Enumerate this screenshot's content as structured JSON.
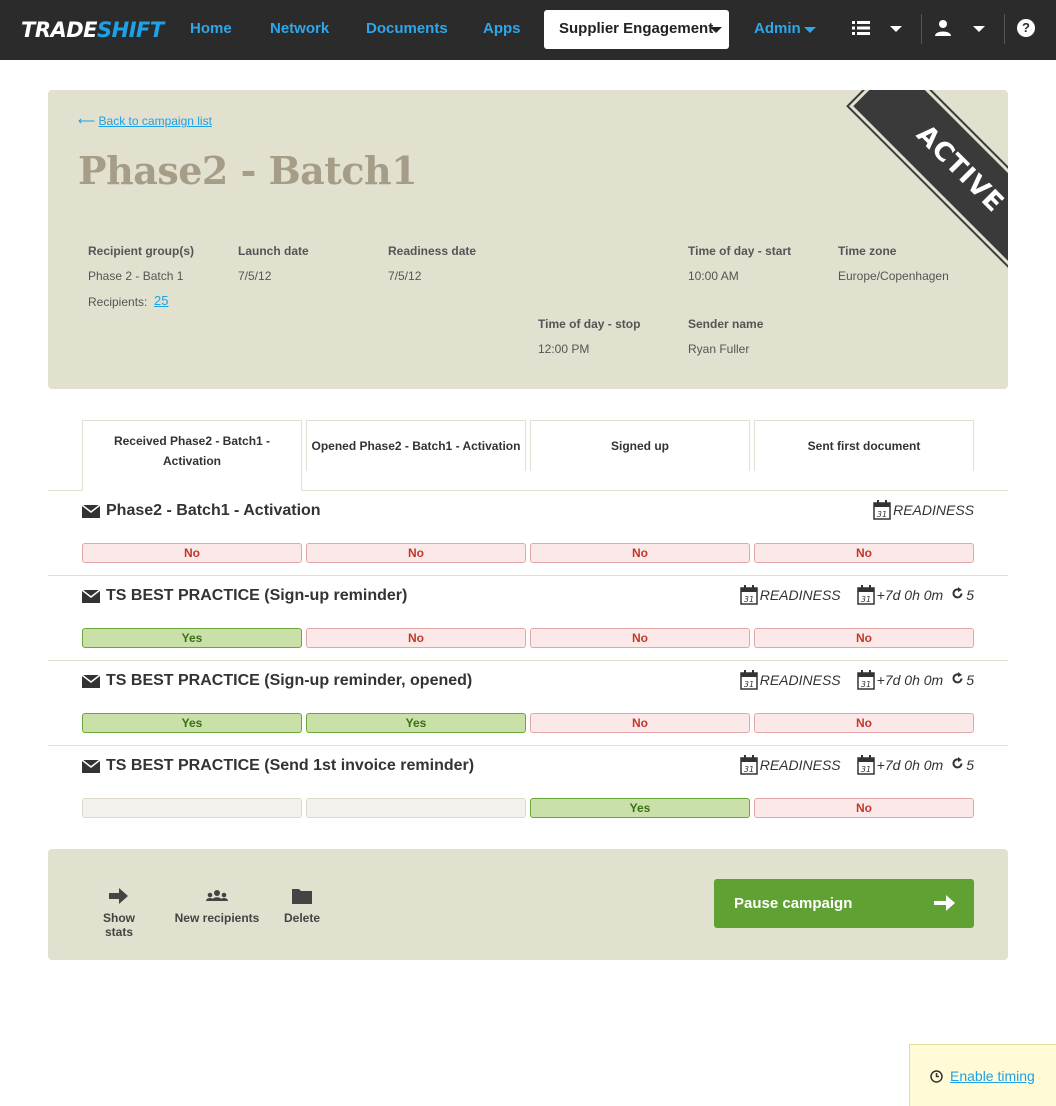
{
  "topbar": {
    "logo_part1": "TRADE",
    "logo_part2": "SHIFT",
    "nav": [
      "Home",
      "Network",
      "Documents",
      "Apps"
    ],
    "app_select": "Supplier Engagement",
    "admin": "Admin",
    "help": "?"
  },
  "campaign": {
    "back_arrow": "⟵",
    "back_label": "Back to campaign list",
    "title": "Phase2 - Batch1",
    "status": "ACTIVE",
    "recipient_groups_label": "Recipient group(s)",
    "recipient_groups_value": "Phase 2 - Batch 1",
    "recipients_label": "Recipients:",
    "recipients_count": "25",
    "launch_date_label": "Launch date",
    "launch_date_value": "7/5/12",
    "readiness_date_label": "Readiness date",
    "readiness_date_value": "7/5/12",
    "tod_start_label": "Time of day - start",
    "tod_start_value": "10:00 AM",
    "timezone_label": "Time zone",
    "timezone_value": "Europe/Copenhagen",
    "tod_stop_label": "Time of day - stop",
    "tod_stop_value": "12:00 PM",
    "sender_label": "Sender name",
    "sender_value": "Ryan Fuller"
  },
  "tabs": [
    "Received Phase2 - Batch1 - Activation",
    "Opened Phase2 - Batch1 - Activation",
    "Signed up",
    "Sent first document"
  ],
  "messages": [
    {
      "title": "Phase2 - Batch1 - Activation",
      "readiness": "READINESS",
      "delay": "",
      "repeat": "",
      "cells": [
        "No",
        "No",
        "No",
        "No"
      ],
      "states": [
        "no",
        "no",
        "no",
        "no"
      ]
    },
    {
      "title": "TS BEST PRACTICE (Sign-up reminder)",
      "readiness": "READINESS",
      "delay": "+7d 0h 0m",
      "repeat": "5",
      "cells": [
        "Yes",
        "No",
        "No",
        "No"
      ],
      "states": [
        "yes",
        "no",
        "no",
        "no"
      ]
    },
    {
      "title": "TS BEST PRACTICE (Sign-up reminder, opened)",
      "readiness": "READINESS",
      "delay": "+7d 0h 0m",
      "repeat": "5",
      "cells": [
        "Yes",
        "Yes",
        "No",
        "No"
      ],
      "states": [
        "yes",
        "yes",
        "no",
        "no"
      ]
    },
    {
      "title": "TS BEST PRACTICE (Send 1st invoice reminder)",
      "readiness": "READINESS",
      "delay": "+7d 0h 0m",
      "repeat": "5",
      "cells": [
        "",
        "",
        "Yes",
        "No"
      ],
      "states": [
        "empty",
        "empty",
        "yes",
        "no"
      ]
    }
  ],
  "footer": {
    "show_stats": "Show stats",
    "new_recipients": "New recipients",
    "delete": "Delete",
    "pause": "Pause campaign"
  },
  "timing": {
    "label": "Enable timing"
  },
  "colors": {
    "accent": "#1ea1e6",
    "panel": "#e2e0cf",
    "yes": "#c9e0a8",
    "no": "#fbe9e9",
    "pause": "#5fa233"
  }
}
